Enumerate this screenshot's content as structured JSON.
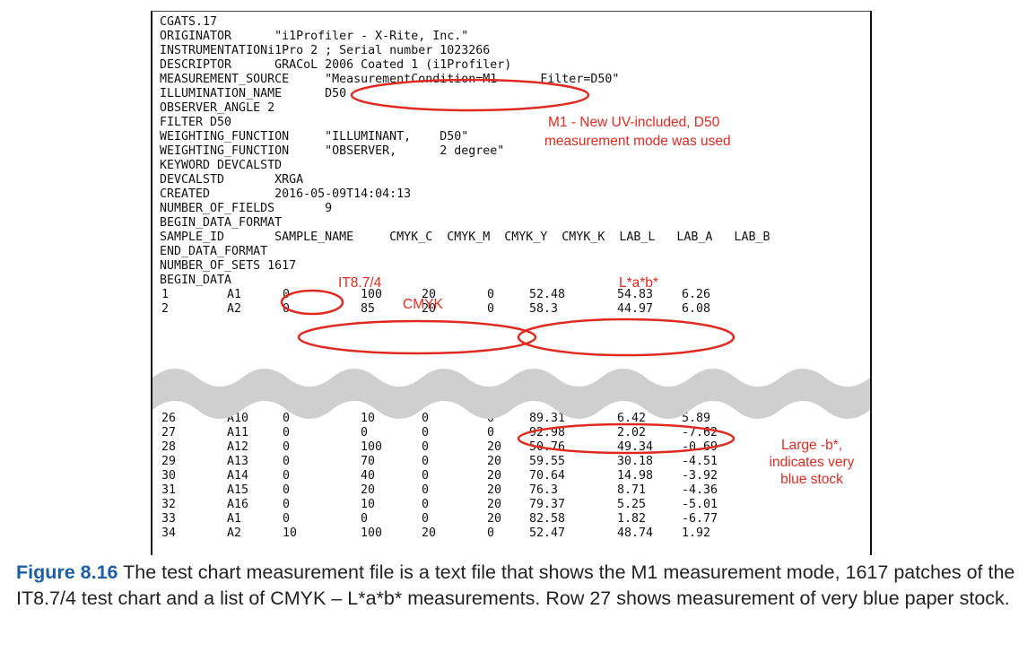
{
  "header_lines": [
    "CGATS.17",
    "ORIGINATOR      \"i1Profiler - X-Rite, Inc.\"",
    "INSTRUMENTATIONi1Pro 2 ; Serial number 1023266",
    "DESCRIPTOR      GRACoL 2006 Coated 1 (i1Profiler)",
    "MEASUREMENT_SOURCE     \"MeasurementCondition=M1      Filter=D50\"",
    "ILLUMINATION_NAME      D50",
    "OBSERVER_ANGLE 2",
    "FILTER D50",
    "WEIGHTING_FUNCTION     \"ILLUMINANT,    D50\"",
    "WEIGHTING_FUNCTION     \"OBSERVER,      2 degree\"",
    "KEYWORD DEVCALSTD",
    "DEVCALSTD       XRGA",
    "CREATED         2016-05-09T14:04:13",
    "NUMBER_OF_FIELDS       9",
    "BEGIN_DATA_FORMAT",
    "SAMPLE_ID       SAMPLE_NAME     CMYK_C  CMYK_M  CMYK_Y  CMYK_K  LAB_L   LAB_A   LAB_B",
    "END_DATA_FORMAT",
    "NUMBER_OF_SETS 1617",
    "BEGIN_DATA"
  ],
  "rows_top": [
    [
      "1",
      "A1",
      "0",
      "100",
      "20",
      "0",
      "52.48",
      "54.83",
      "6.26"
    ],
    [
      "2",
      "A2",
      "0",
      "85",
      "20",
      "0",
      "58.3",
      "44.97",
      "6.08"
    ]
  ],
  "rows_bottom": [
    [
      "26",
      "A10",
      "0",
      "10",
      "0",
      "0",
      "89.31",
      "6.42",
      "5.89"
    ],
    [
      "27",
      "A11",
      "0",
      "0",
      "0",
      "0",
      "92.98",
      "2.02",
      "-7.62"
    ],
    [
      "28",
      "A12",
      "0",
      "100",
      "0",
      "20",
      "50.76",
      "49.34",
      "-0.69"
    ],
    [
      "29",
      "A13",
      "0",
      "70",
      "0",
      "20",
      "59.55",
      "30.18",
      "-4.51"
    ],
    [
      "30",
      "A14",
      "0",
      "40",
      "0",
      "20",
      "70.64",
      "14.98",
      "-3.92"
    ],
    [
      "31",
      "A15",
      "0",
      "20",
      "0",
      "20",
      "76.3",
      "8.71",
      "-4.36"
    ],
    [
      "32",
      "A16",
      "0",
      "10",
      "0",
      "20",
      "79.37",
      "5.25",
      "-5.01"
    ],
    [
      "33",
      "A1",
      "0",
      "0",
      "0",
      "20",
      "82.58",
      "1.82",
      "-6.77"
    ],
    [
      "34",
      "A2",
      "10",
      "100",
      "20",
      "0",
      "52.47",
      "48.74",
      "1.92"
    ]
  ],
  "annotations": {
    "m1_line1": "M1 - New UV-included, D50",
    "m1_line2": "measurement mode was used",
    "it8": "IT8.7/4",
    "cmyk": "CMYK",
    "lab": "L*a*b*",
    "large_b_line1": "Large -b*,",
    "large_b_line2": "indicates very",
    "large_b_line3": "blue stock"
  },
  "caption": {
    "label": "Figure 8.16",
    "text": "  The test chart measurement file is a text file that shows the M1 measurement mode, 1617 patches of the IT8.7/4 test chart and a list of CMYK – L*a*b* measurements. Row 27 shows measurement of very blue paper stock."
  },
  "colors": {
    "annotation": "#e02a1f",
    "figure_label": "#1a5fa8",
    "wave_band": "#cfcfcf"
  }
}
